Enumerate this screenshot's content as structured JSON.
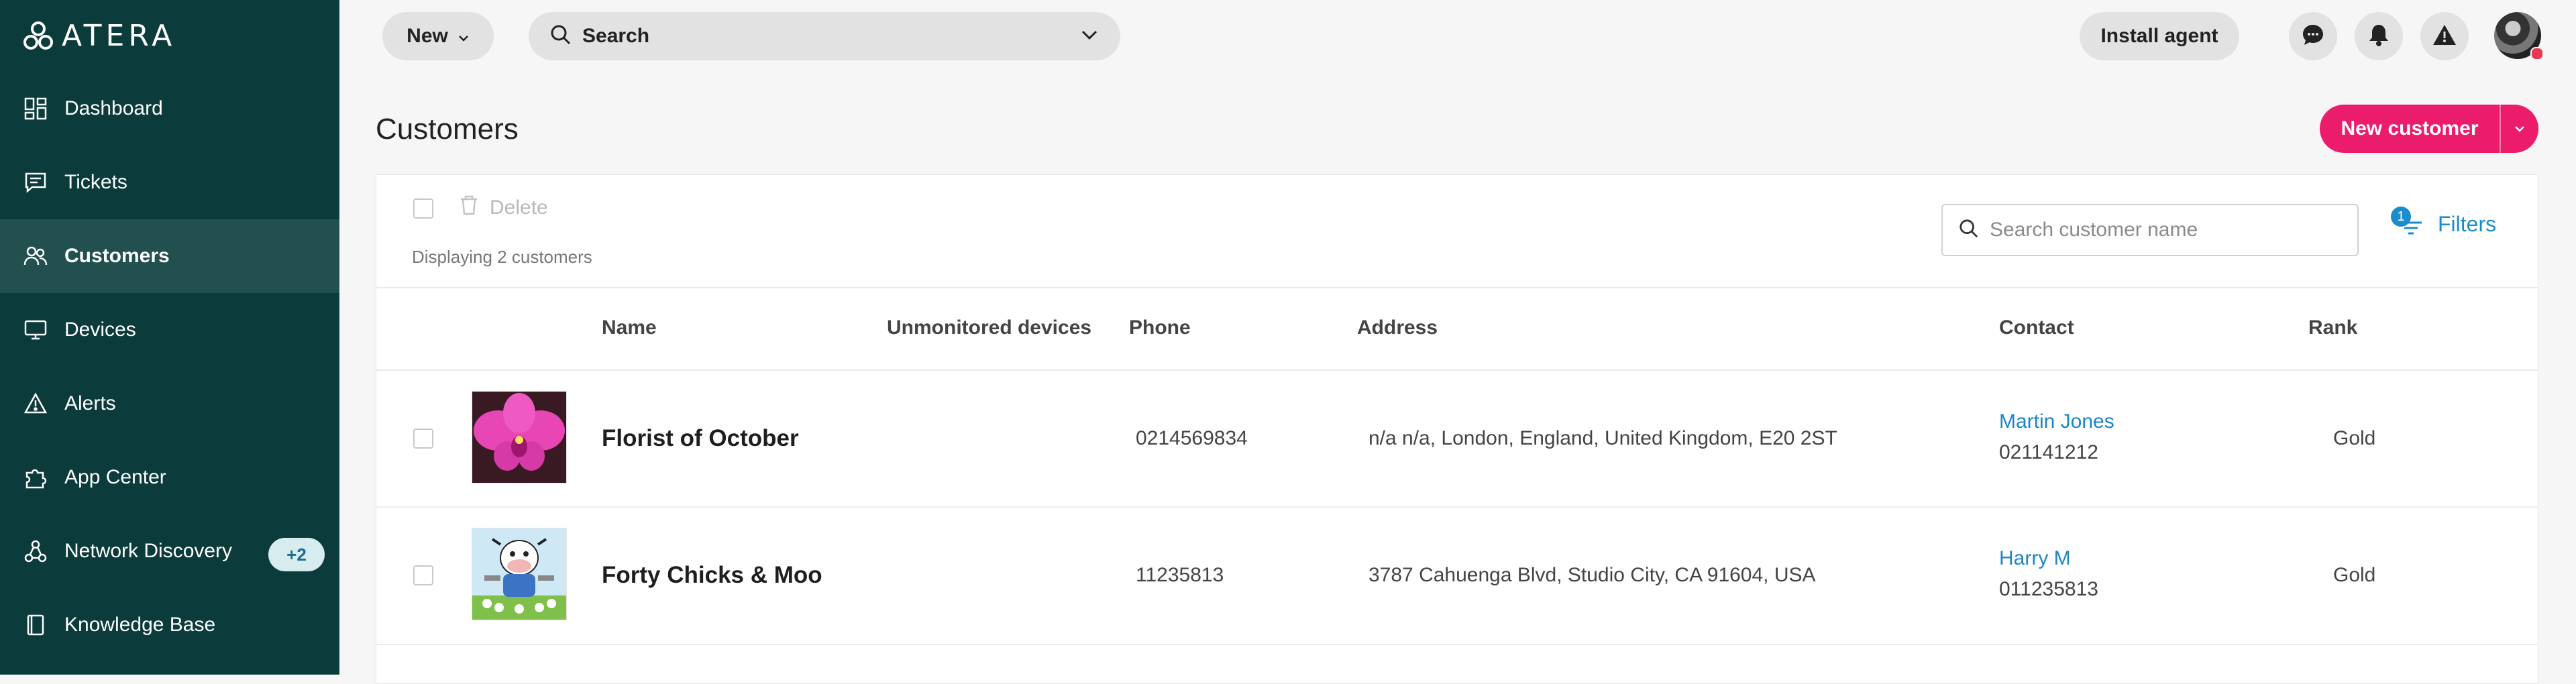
{
  "brand": {
    "logo_text": "ATERA"
  },
  "sidebar": {
    "items": [
      {
        "label": "Dashboard",
        "icon": "dashboard-icon"
      },
      {
        "label": "Tickets",
        "icon": "ticket-icon"
      },
      {
        "label": "Customers",
        "icon": "customers-icon",
        "active": true
      },
      {
        "label": "Devices",
        "icon": "devices-icon"
      },
      {
        "label": "Alerts",
        "icon": "alert-icon"
      },
      {
        "label": "App Center",
        "icon": "puzzle-icon"
      },
      {
        "label": "Network Discovery",
        "icon": "network-icon",
        "badge": "+2"
      },
      {
        "label": "Knowledge Base",
        "icon": "book-icon"
      }
    ]
  },
  "topbar": {
    "new_label": "New",
    "search_label": "Search",
    "install_label": "Install agent",
    "icons": [
      "chat-icon",
      "bell-icon",
      "warning-icon",
      "user-avatar"
    ]
  },
  "page": {
    "title": "Customers",
    "new_customer_label": "New customer"
  },
  "toolbar": {
    "delete_label": "Delete",
    "displaying_text": "Displaying 2 customers",
    "search_placeholder": "Search customer name",
    "filters_label": "Filters",
    "filter_count": "1"
  },
  "table": {
    "columns": [
      "Name",
      "Unmonitored devices",
      "Phone",
      "Address",
      "Contact",
      "Rank"
    ],
    "rows": [
      {
        "name": "Florist of October",
        "unmonitored": "",
        "phone": "0214569834",
        "address": "n/a n/a, London, England, United Kingdom, E20 2ST",
        "contact_name": "Martin Jones",
        "contact_phone": "021141212",
        "rank": "Gold",
        "image": "orchid-photo"
      },
      {
        "name": "Forty Chicks & Moo",
        "unmonitored": "",
        "phone": "11235813",
        "address": "3787 Cahuenga Blvd, Studio City, CA 91604, USA",
        "contact_name": "Harry M",
        "contact_phone": "011235813",
        "rank": "Gold",
        "image": "cartoon-cow-logo"
      }
    ]
  },
  "colors": {
    "sidebar_bg": "#0c3b3b",
    "sidebar_active": "#21504f",
    "accent_pink": "#ec1c6c",
    "link_blue": "#1a86c6"
  }
}
